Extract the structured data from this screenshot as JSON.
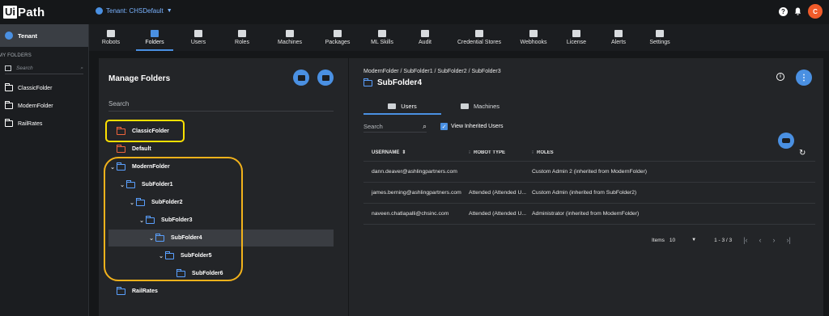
{
  "topbar": {
    "logo_box": "Ui",
    "logo_text": "Path",
    "tenant_label": "Tenant: CHSDefault",
    "avatar_initial": "C"
  },
  "sidebar": {
    "tenant": "Tenant",
    "heading": "MY FOLDERS",
    "search_placeholder": "Search",
    "items": [
      {
        "label": "ClassicFolder"
      },
      {
        "label": "ModernFolder"
      },
      {
        "label": "RailRates"
      }
    ]
  },
  "nav": {
    "items": [
      {
        "label": "Robots",
        "icon": "robot-icon"
      },
      {
        "label": "Folders",
        "icon": "folder-icon",
        "active": true
      },
      {
        "label": "Users",
        "icon": "users-icon"
      },
      {
        "label": "Roles",
        "icon": "roles-icon"
      },
      {
        "label": "Machines",
        "icon": "monitor-icon"
      },
      {
        "label": "Packages",
        "icon": "package-icon"
      },
      {
        "label": "ML Skills",
        "icon": "ml-skills-icon"
      },
      {
        "label": "Audit",
        "icon": "audit-icon"
      },
      {
        "label": "Credential Stores",
        "icon": "shield-icon"
      },
      {
        "label": "Webhooks",
        "icon": "webhooks-icon"
      },
      {
        "label": "License",
        "icon": "license-icon"
      },
      {
        "label": "Alerts",
        "icon": "bell-icon"
      },
      {
        "label": "Settings",
        "icon": "gear-icon"
      }
    ]
  },
  "manage": {
    "title": "Manage Folders",
    "search_placeholder": "Search",
    "tree": [
      {
        "label": "ClassicFolder",
        "level": 0,
        "expandable": false,
        "color": "#f0643c"
      },
      {
        "label": "Default",
        "level": 0,
        "expandable": false,
        "color": "#f0643c"
      },
      {
        "label": "ModernFolder",
        "level": 0,
        "expandable": true,
        "color": "#5aa0ff"
      },
      {
        "label": "SubFolder1",
        "level": 1,
        "expandable": true,
        "color": "#5aa0ff"
      },
      {
        "label": "SubFolder2",
        "level": 2,
        "expandable": true,
        "color": "#5aa0ff"
      },
      {
        "label": "SubFolder3",
        "level": 3,
        "expandable": true,
        "color": "#5aa0ff"
      },
      {
        "label": "SubFolder4",
        "level": 4,
        "expandable": true,
        "selected": true,
        "color": "#5aa0ff"
      },
      {
        "label": "SubFolder5",
        "level": 5,
        "expandable": true,
        "color": "#5aa0ff"
      },
      {
        "label": "SubFolder6",
        "level": 6,
        "expandable": false,
        "color": "#5aa0ff"
      },
      {
        "label": "RailRates",
        "level": 0,
        "expandable": false,
        "color": "#5aa0ff"
      }
    ]
  },
  "detail": {
    "breadcrumb": "ModernFolder / SubFolder1 / SubFolder2 / SubFolder3",
    "title": "SubFolder4",
    "tabs": [
      {
        "label": "Users",
        "active": true
      },
      {
        "label": "Machines"
      }
    ],
    "search_placeholder": "Search",
    "inherited_label": "View Inherited Users",
    "inherited_checked": true,
    "columns": [
      "USERNAME",
      "ROBOT TYPE",
      "ROLES"
    ],
    "rows": [
      {
        "username": "dann.deaver@ashlingpartners.com",
        "robot_type": "",
        "roles": "Custom Admin 2 (inherited from ModernFolder)"
      },
      {
        "username": "james.berning@ashlingpartners.com",
        "robot_type": "Attended (Attended U...",
        "roles": "Custom Admin (inherited from SubFolder2)"
      },
      {
        "username": "naveen.chatlapalli@chsinc.com",
        "robot_type": "Attended (Attended U...",
        "roles": "Administrator (inherited from ModernFolder)"
      }
    ],
    "pager": {
      "items_label": "Items",
      "per_page": "10",
      "range": "1 - 3 / 3"
    }
  },
  "colors": {
    "accent": "#4a90e2",
    "avatar": "#f05b2a",
    "highlight_yellow": "#ffe100",
    "highlight_orange": "#f2b21b"
  }
}
